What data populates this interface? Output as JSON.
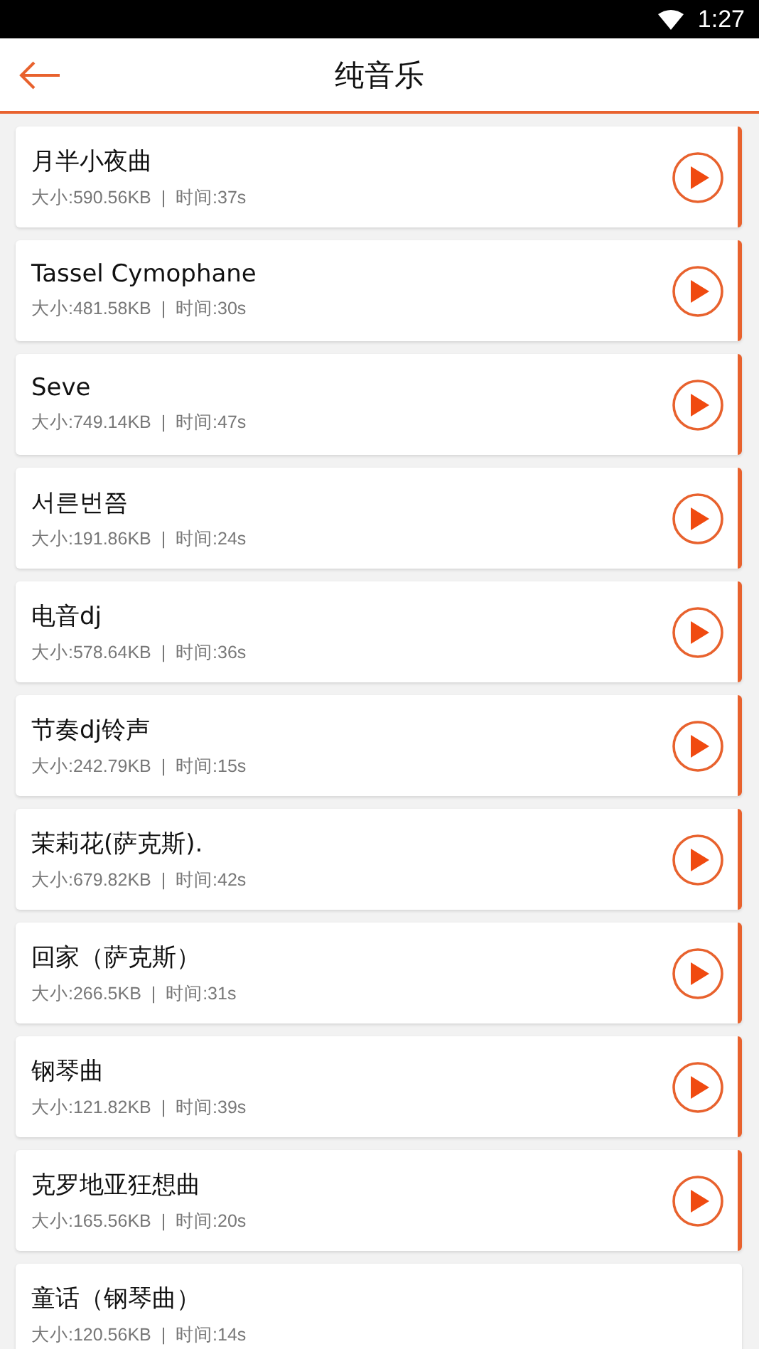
{
  "status_bar": {
    "time": "1:27"
  },
  "header": {
    "title": "纯音乐"
  },
  "songs": [
    {
      "title": "月半小夜曲",
      "info": "大小:590.56KB  |  时间:37s",
      "show_play": true
    },
    {
      "title": "Tassel Cymophane",
      "info": "大小:481.58KB  |  时间:30s",
      "show_play": true
    },
    {
      "title": "Seve",
      "info": "大小:749.14KB  |  时间:47s",
      "show_play": true
    },
    {
      "title": "서른번쯤",
      "info": "大小:191.86KB  |  时间:24s",
      "show_play": true
    },
    {
      "title": "电音dj",
      "info": "大小:578.64KB  |  时间:36s",
      "show_play": true
    },
    {
      "title": "节奏dj铃声",
      "info": "大小:242.79KB  |  时间:15s",
      "show_play": true
    },
    {
      "title": "茉莉花(萨克斯).",
      "info": "大小:679.82KB  |  时间:42s",
      "show_play": true
    },
    {
      "title": "回家（萨克斯）",
      "info": "大小:266.5KB  |  时间:31s",
      "show_play": true
    },
    {
      "title": "钢琴曲",
      "info": "大小:121.82KB  |  时间:39s",
      "show_play": true
    },
    {
      "title": "克罗地亚狂想曲",
      "info": "大小:165.56KB  |  时间:20s",
      "show_play": true
    },
    {
      "title": "童话（钢琴曲）",
      "info": "大小:120.56KB  |  时间:14s",
      "show_play": false
    }
  ]
}
